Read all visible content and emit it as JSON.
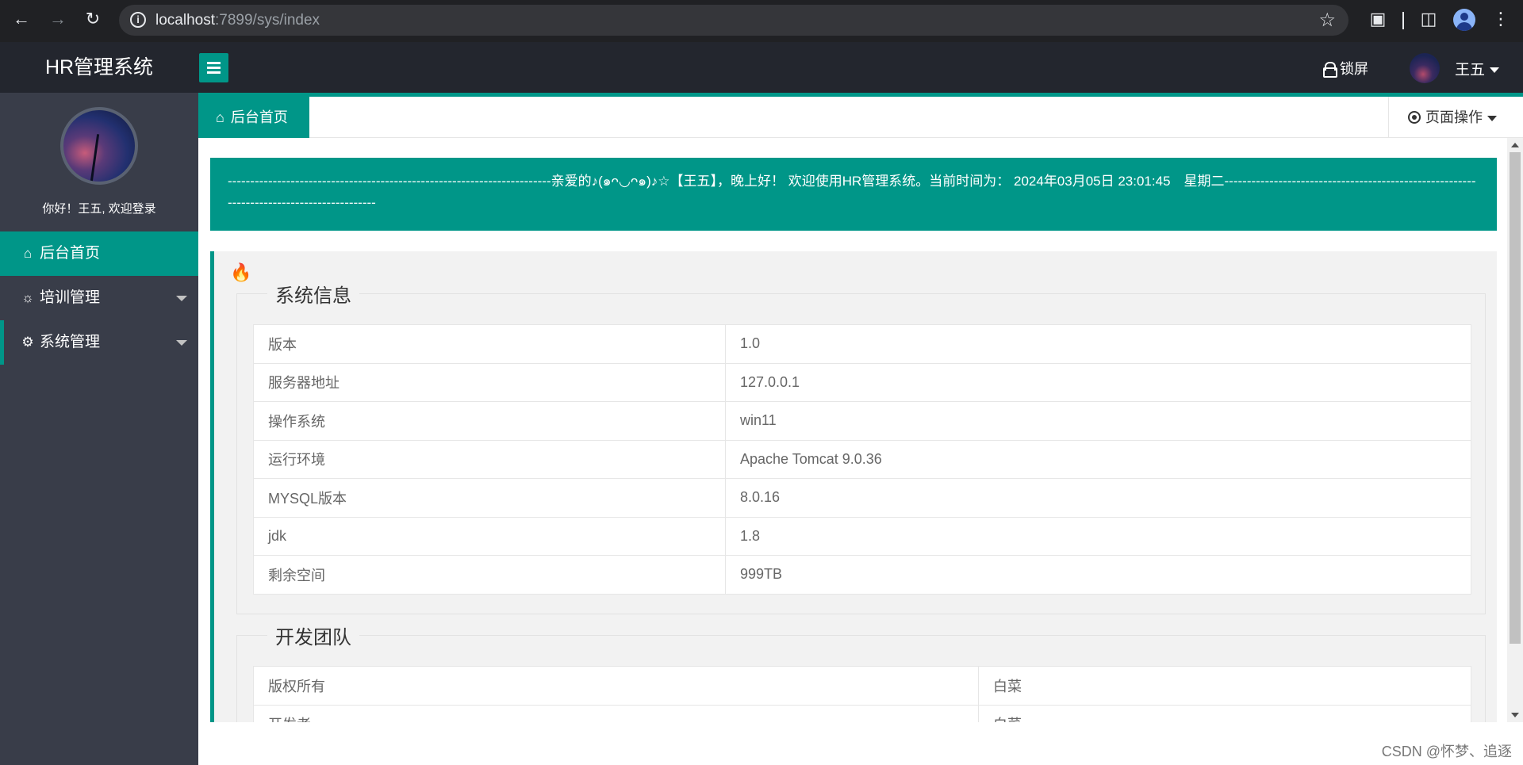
{
  "browser": {
    "url_host": "localhost",
    "url_rest": ":7899/sys/index"
  },
  "header": {
    "app_title": "HR管理系统",
    "lock_label": "锁屏",
    "user_name": "王五"
  },
  "sidebar": {
    "greeting": "你好！王五, 欢迎登录",
    "items": [
      {
        "label": "后台首页"
      },
      {
        "label": "培训管理"
      },
      {
        "label": "系统管理"
      }
    ]
  },
  "tabs": {
    "home_label": "后台首页",
    "page_ops_label": "页面操作"
  },
  "welcome": {
    "text": "------------------------------------------------------------------------亲爱的♪(๑ᴖ◡ᴖ๑)♪☆【王五】，晚上好！ 欢迎使用HR管理系统。当前时间为： 2024年03月05日 23:01:45　星期二-----------------------------------------------------------------------------------------"
  },
  "system_info": {
    "title": "系统信息",
    "rows": [
      [
        "版本",
        "1.0"
      ],
      [
        "服务器地址",
        "127.0.0.1"
      ],
      [
        "操作系统",
        "win11"
      ],
      [
        "运行环境",
        "Apache Tomcat 9.0.36"
      ],
      [
        "MYSQL版本",
        "8.0.16"
      ],
      [
        "jdk",
        "1.8"
      ],
      [
        "剩余空间",
        "999TB"
      ]
    ]
  },
  "dev_team": {
    "title": "开发团队",
    "rows": [
      [
        "版权所有",
        "白菜"
      ],
      [
        "开发者",
        "白菜"
      ]
    ]
  },
  "watermark": "CSDN @怀梦、追逐"
}
